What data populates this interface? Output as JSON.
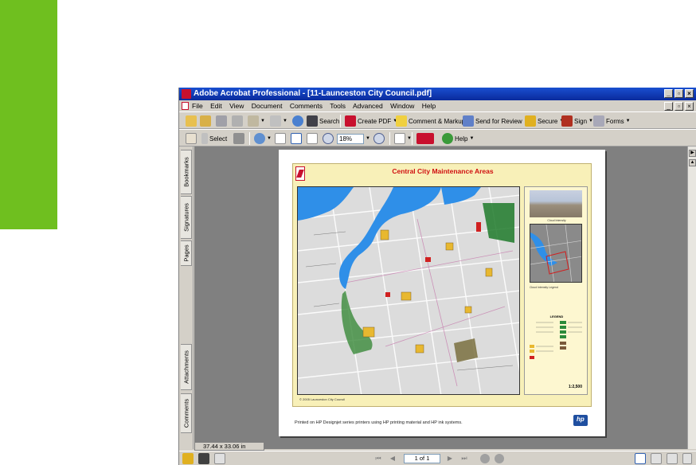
{
  "window": {
    "title": "Adobe Acrobat Professional - [11-Launceston City Council.pdf]",
    "controls": [
      "_",
      "▫",
      "×"
    ]
  },
  "menus": [
    "File",
    "Edit",
    "View",
    "Document",
    "Comments",
    "Tools",
    "Advanced",
    "Window",
    "Help"
  ],
  "toolbar1": {
    "search_label": "Search",
    "create_pdf_label": "Create PDF",
    "comment_markup_label": "Comment & Markup",
    "send_review_label": "Send for Review",
    "secure_label": "Secure",
    "sign_label": "Sign",
    "forms_label": "Forms"
  },
  "toolbar2": {
    "select_label": "Select",
    "zoom_value": "18%",
    "help_label": "Help"
  },
  "nav_tabs": [
    "Bookmarks",
    "Signatures",
    "Pages",
    "Attachments",
    "Comments"
  ],
  "document": {
    "poster_title": "Central City Maintenance Areas",
    "copyright": "© 2005 Launceston City Council",
    "photo_caption": "Cloud Intensity",
    "legend_title": "Cloud Intensity Legend",
    "legend_heading": "LEGEND",
    "scale": "1:2,500",
    "caption": "Printed on HP Designjet series printers using HP printing material and HP ink systems."
  },
  "page_size": "37.44 x 33.06 in",
  "status": {
    "page_indicator": "1 of 1"
  },
  "colors": {
    "green_bar": "#6fbf1f",
    "title_bar": "#0a2a9c",
    "poster_title": "#d01010",
    "poster_bg": "#f8f0b8",
    "water": "#2f8fe8"
  }
}
